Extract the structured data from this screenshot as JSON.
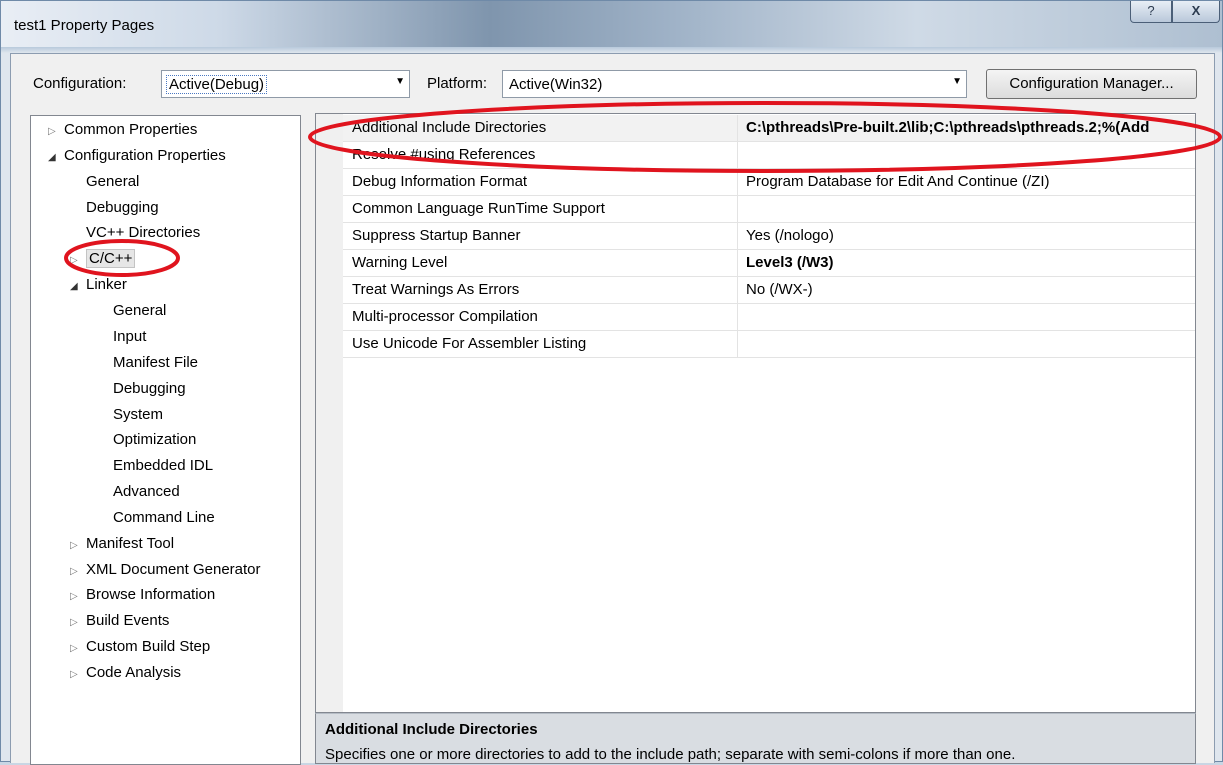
{
  "window": {
    "title": "test1 Property Pages",
    "help_glyph": "?",
    "close_glyph": "X"
  },
  "toolbar": {
    "configuration_label": "Configuration:",
    "configuration_value": "Active(Debug)",
    "platform_label": "Platform:",
    "platform_value": "Active(Win32)",
    "config_manager_label": "Configuration Manager..."
  },
  "tree": {
    "items": [
      {
        "label": "Common Properties",
        "expander": "▷"
      },
      {
        "label": "Configuration Properties",
        "expander": "◢"
      },
      {
        "label": "General",
        "expander": ""
      },
      {
        "label": "Debugging",
        "expander": ""
      },
      {
        "label": "VC++ Directories",
        "expander": ""
      },
      {
        "label": "C/C++",
        "expander": "▷"
      },
      {
        "label": "Linker",
        "expander": "◢"
      },
      {
        "label": "General",
        "expander": ""
      },
      {
        "label": "Input",
        "expander": ""
      },
      {
        "label": "Manifest File",
        "expander": ""
      },
      {
        "label": "Debugging",
        "expander": ""
      },
      {
        "label": "System",
        "expander": ""
      },
      {
        "label": "Optimization",
        "expander": ""
      },
      {
        "label": "Embedded IDL",
        "expander": ""
      },
      {
        "label": "Advanced",
        "expander": ""
      },
      {
        "label": "Command Line",
        "expander": ""
      },
      {
        "label": "Manifest Tool",
        "expander": "▷"
      },
      {
        "label": "XML Document Generator",
        "expander": "▷"
      },
      {
        "label": "Browse Information",
        "expander": "▷"
      },
      {
        "label": "Build Events",
        "expander": "▷"
      },
      {
        "label": "Custom Build Step",
        "expander": "▷"
      },
      {
        "label": "Code Analysis",
        "expander": "▷"
      }
    ]
  },
  "properties": {
    "rows": [
      {
        "name": "Additional Include Directories",
        "value": "C:\\pthreads\\Pre-built.2\\lib;C:\\pthreads\\pthreads.2;%(Add"
      },
      {
        "name": "Resolve #using References",
        "value": ""
      },
      {
        "name": "Debug Information Format",
        "value": "Program Database for Edit And Continue (/ZI)"
      },
      {
        "name": "Common Language RunTime Support",
        "value": ""
      },
      {
        "name": "Suppress Startup Banner",
        "value": "Yes (/nologo)"
      },
      {
        "name": "Warning Level",
        "value": "Level3 (/W3)"
      },
      {
        "name": "Treat Warnings As Errors",
        "value": "No (/WX-)"
      },
      {
        "name": "Multi-processor Compilation",
        "value": ""
      },
      {
        "name": "Use Unicode For Assembler Listing",
        "value": ""
      }
    ]
  },
  "description": {
    "title": "Additional Include Directories",
    "text": "Specifies one or more directories to add to the include path; separate with semi-colons if more than one."
  },
  "colors": {
    "annotation": "#e0141e",
    "tree_selected_bg": "#e6e6e6",
    "description_bg": "#d9dde2"
  }
}
